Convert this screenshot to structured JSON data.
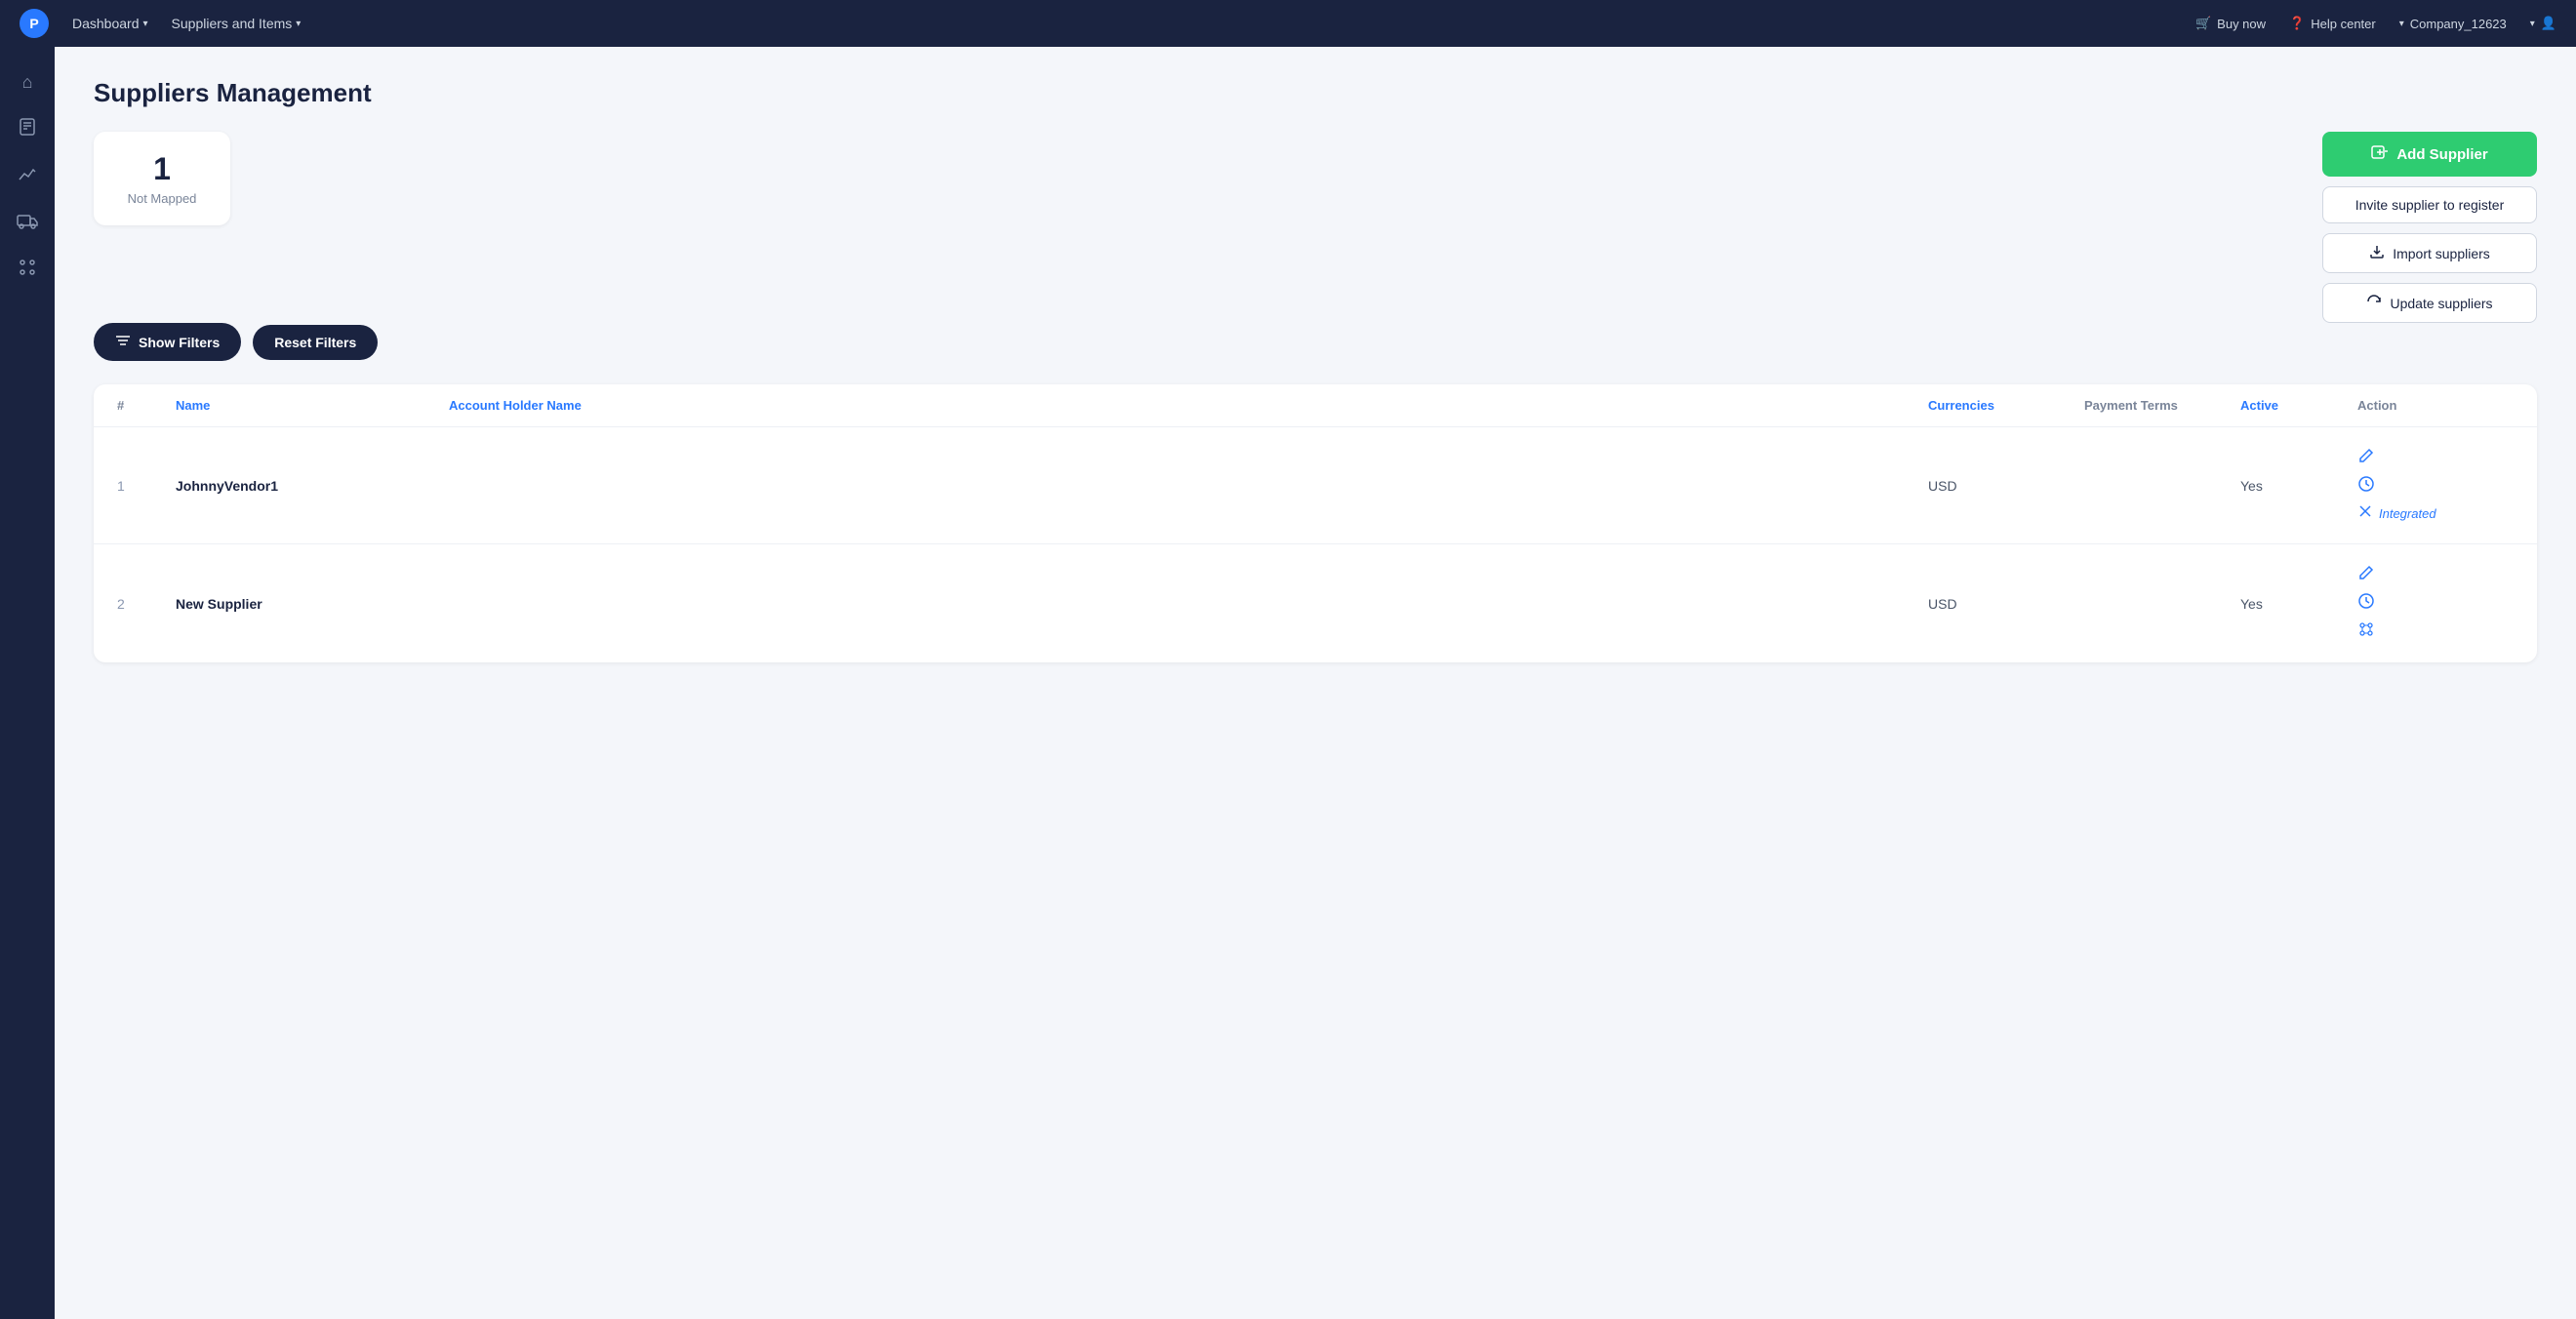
{
  "topnav": {
    "logo": "P",
    "links": [
      {
        "label": "Dashboard",
        "has_chevron": true
      },
      {
        "label": "Suppliers and Items",
        "has_chevron": true
      }
    ],
    "right": [
      {
        "icon": "cart-icon",
        "label": "Buy now"
      },
      {
        "icon": "help-icon",
        "label": "Help center"
      },
      {
        "icon": "company-icon",
        "label": "Company_12623",
        "has_chevron": true
      },
      {
        "icon": "user-icon",
        "label": "",
        "has_chevron": true
      }
    ]
  },
  "sidebar": {
    "icons": [
      {
        "name": "home-icon",
        "symbol": "⌂"
      },
      {
        "name": "orders-icon",
        "symbol": "📋"
      },
      {
        "name": "analytics-icon",
        "symbol": "📈"
      },
      {
        "name": "delivery-icon",
        "symbol": "🚚"
      },
      {
        "name": "catalog-icon",
        "symbol": "≡"
      }
    ]
  },
  "page": {
    "title": "Suppliers Management"
  },
  "stat_card": {
    "number": "1",
    "label": "Not Mapped"
  },
  "buttons": {
    "add_supplier": "Add Supplier",
    "invite_supplier": "Invite supplier to register",
    "import_suppliers": "Import suppliers",
    "update_suppliers": "Update suppliers",
    "show_filters": "Show Filters",
    "reset_filters": "Reset Filters"
  },
  "table": {
    "headers": [
      {
        "label": "#",
        "color": "normal"
      },
      {
        "label": "Name",
        "color": "blue"
      },
      {
        "label": "Account Holder Name",
        "color": "blue"
      },
      {
        "label": "Currencies",
        "color": "blue"
      },
      {
        "label": "Payment Terms",
        "color": "normal"
      },
      {
        "label": "Active",
        "color": "blue"
      },
      {
        "label": "Action",
        "color": "normal"
      }
    ],
    "rows": [
      {
        "num": "1",
        "name": "JohnnyVendor1",
        "account_holder": "",
        "currencies": "USD",
        "payment_terms": "",
        "active": "Yes",
        "actions": [
          {
            "icon": "edit-icon",
            "label": ""
          },
          {
            "icon": "clock-icon",
            "label": ""
          },
          {
            "icon": "integrated-icon",
            "label": "Integrated",
            "style": "integrated"
          }
        ]
      },
      {
        "num": "2",
        "name": "New Supplier",
        "account_holder": "",
        "currencies": "USD",
        "payment_terms": "",
        "active": "Yes",
        "actions": [
          {
            "icon": "edit-icon",
            "label": ""
          },
          {
            "icon": "clock-icon",
            "label": ""
          },
          {
            "icon": "map-icon",
            "label": ""
          }
        ]
      }
    ]
  }
}
